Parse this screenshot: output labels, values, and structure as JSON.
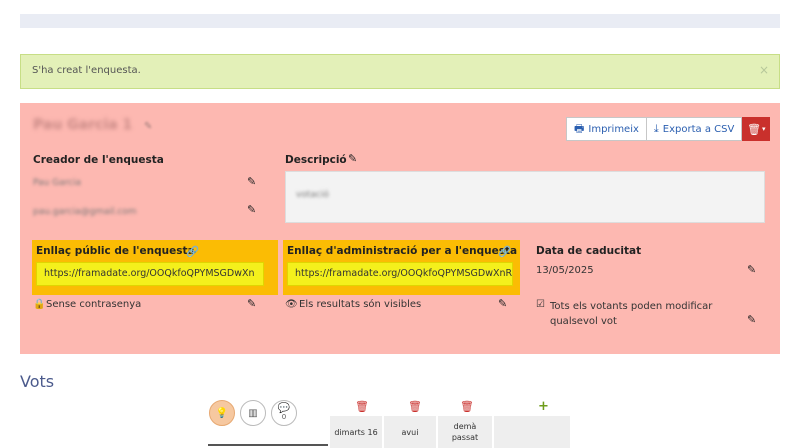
{
  "alert": {
    "message": "S'ha creat l'enquesta.",
    "close": "×"
  },
  "poll": {
    "title": "Pau Garcia 1",
    "edit_icon": "pencil-icon",
    "actions": {
      "print": "Imprimeix",
      "export": "Exporta a CSV",
      "delete_icon": "trash-icon"
    },
    "creator": {
      "label": "Creador de l'enquesta",
      "name": "Pau Garcia",
      "email": "pau.garcia@gmail.com"
    },
    "description": {
      "label": "Descripció",
      "value": "votació"
    },
    "public_link": {
      "label": "Enllaç públic de l'enquesta",
      "url": "https://framadate.org/OOQkfoQPYMSGDwXn"
    },
    "admin_link": {
      "label": "Enllaç d'administració per a l'enquesta",
      "url": "https://framadate.org/OOQkfoQPYMSGDwXnRE"
    },
    "expiry": {
      "label": "Data de caducitat",
      "value": "13/05/2025"
    },
    "password": "Sense contrasenya",
    "results": "Els resultats són visibles",
    "modify": "Tots els votants poden modificar qualsevol vot"
  },
  "votes": {
    "title": "Vots",
    "comment_count": "0",
    "columns": [
      {
        "line1": "dimarts 16",
        "line2": ""
      },
      {
        "line1": "avui",
        "line2": ""
      },
      {
        "line1": "demà",
        "line2": "passat"
      }
    ],
    "add": "+"
  },
  "colors": {
    "panel": "#fdb8b1",
    "link_highlight": "#fbbc04",
    "input_highlight": "#f4f01c",
    "alert": "#e3f0b8",
    "danger": "#c9302c"
  }
}
